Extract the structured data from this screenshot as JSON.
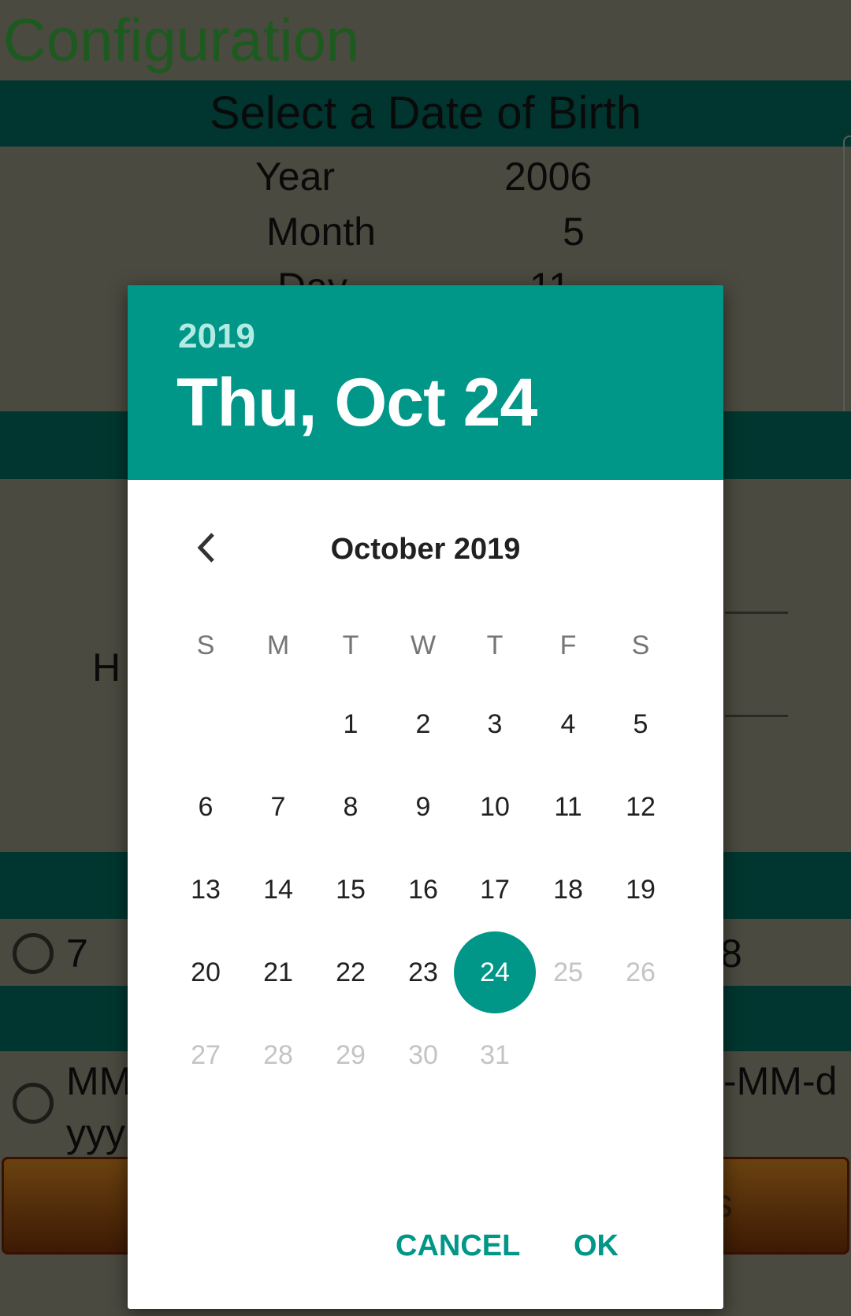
{
  "page": {
    "title": "Configuration",
    "section_title": "Select a Date of Birth",
    "fields": [
      {
        "label": "Year",
        "value": "2006"
      },
      {
        "label": "Month",
        "value": "5"
      },
      {
        "label": "Day",
        "value": "11"
      }
    ],
    "partial_label": "H",
    "radio_options": [
      {
        "left": "7",
        "right": "8"
      },
      {
        "left_line1": "MM",
        "left_line2": "yyy",
        "right": "-MM-d"
      }
    ],
    "button_partial": "s"
  },
  "dialog": {
    "year": "2019",
    "date": "Thu, Oct 24",
    "month_label": "October 2019",
    "weekdays": [
      "S",
      "M",
      "T",
      "W",
      "T",
      "F",
      "S"
    ],
    "first_weekday": 2,
    "days_in_month": 31,
    "selected_day": 24,
    "max_enabled_day": 24,
    "cancel_label": "CANCEL",
    "ok_label": "OK",
    "accent_color": "#009688"
  }
}
